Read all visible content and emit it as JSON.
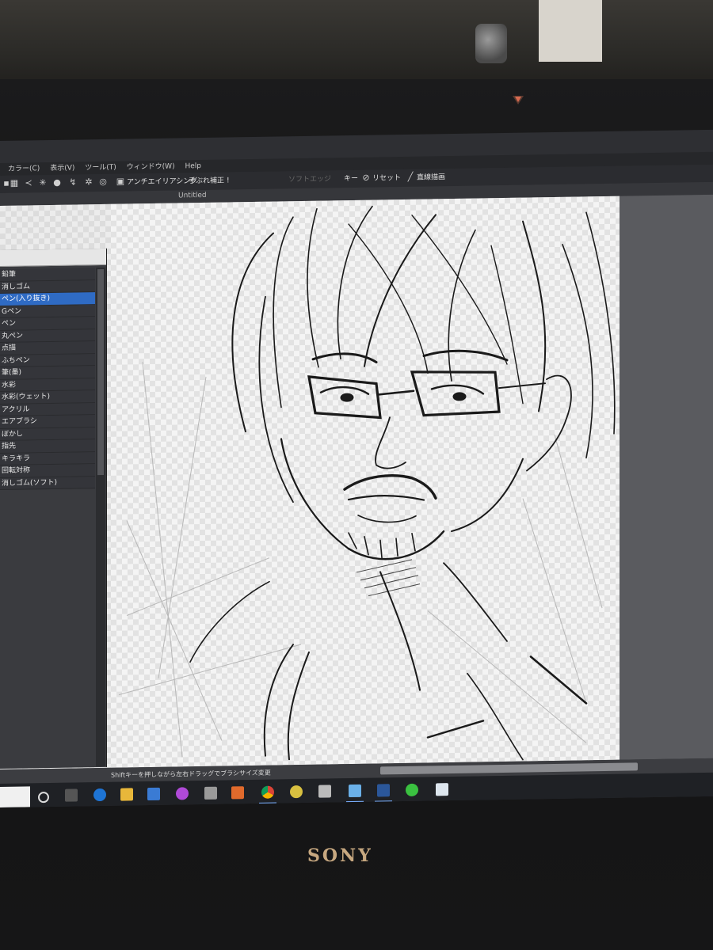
{
  "menu": [
    "カラー(C)",
    "表示(V)",
    "ツール(T)",
    "ウィンドウ(W)",
    "Help"
  ],
  "toolbar": {
    "antialias_label": "アンチエイリアシング",
    "stabilizer_label": "手ぶれ補正",
    "stabilizer_value": "!",
    "soft_edge_label": "ソフトエッジ",
    "key_label": "キー",
    "reset_label": "リセット",
    "line_label": "直線描画"
  },
  "document": {
    "title": "Untitled"
  },
  "brushes": [
    {
      "label": "鉛筆"
    },
    {
      "label": "消しゴム"
    },
    {
      "label": "ペン(入り抜き)",
      "selected": true
    },
    {
      "label": "Gペン"
    },
    {
      "label": "ペン"
    },
    {
      "label": "丸ペン"
    },
    {
      "label": "点描"
    },
    {
      "label": "ふちペン"
    },
    {
      "label": "筆(墨)"
    },
    {
      "label": "水彩"
    },
    {
      "label": "水彩(ウェット)"
    },
    {
      "label": "アクリル"
    },
    {
      "label": "エアブラシ"
    },
    {
      "label": "ぼかし"
    },
    {
      "label": "指先"
    },
    {
      "label": "キラキラ"
    },
    {
      "label": "回転対称"
    },
    {
      "label": "消しゴム(ソフト)"
    }
  ],
  "status": {
    "hint": "Shiftキーを押しながら左右ドラッグでブラシサイズ変更"
  },
  "monitor": {
    "brand": "SONY"
  },
  "colors": {
    "selection": "#2f6bc4",
    "background": "#2e2f33"
  }
}
